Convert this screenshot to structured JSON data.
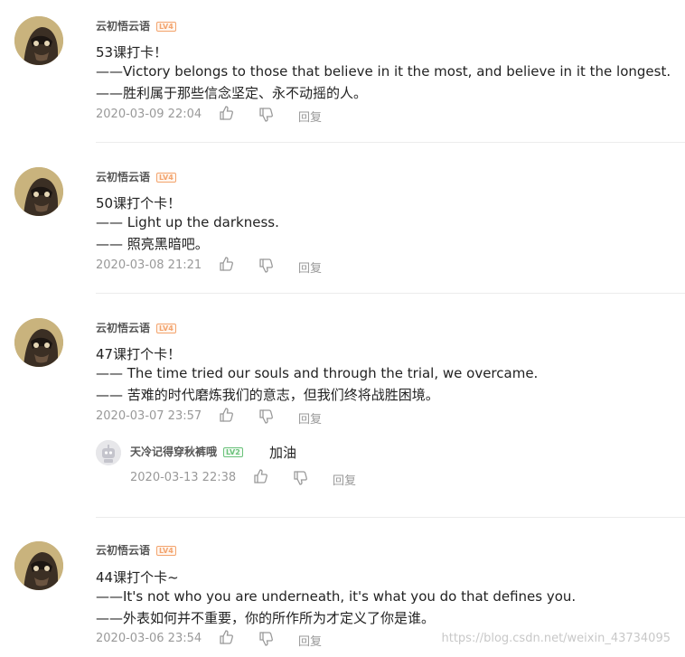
{
  "comments": [
    {
      "username": "云初悟云语",
      "level": "LV4",
      "lines": [
        "53课打卡！",
        "——Victory belongs to those that believe in it the most, and believe in it the longest.",
        "——胜利属于那些信念坚定、永不动摇的人。"
      ],
      "time": "2020-03-09 22:04",
      "reply_label": "回复"
    },
    {
      "username": "云初悟云语",
      "level": "LV4",
      "lines": [
        "50课打个卡！",
        "—— Light up the darkness.",
        "—— 照亮黑暗吧。"
      ],
      "time": "2020-03-08 21:21",
      "reply_label": "回复"
    },
    {
      "username": "云初悟云语",
      "level": "LV4",
      "lines": [
        "47课打个卡！",
        "—— The time tried our souls and through the trial, we overcame.",
        "—— 苦难的时代磨炼我们的意志，但我们终将战胜困境。"
      ],
      "time": "2020-03-07 23:57",
      "reply_label": "回复",
      "reply": {
        "username": "天冷记得穿秋裤哦",
        "level": "LV2",
        "text": "加油",
        "time": "2020-03-13 22:38",
        "reply_label": "回复"
      }
    },
    {
      "username": "云初悟云语",
      "level": "LV4",
      "lines": [
        "44课打个卡~",
        "——It's not who you are underneath, it's what you do that defines you.",
        "——外表如何并不重要，你的所作所为才定义了你是谁。"
      ],
      "time": "2020-03-06 23:54",
      "reply_label": "回复"
    }
  ],
  "watermark": "https://blog.csdn.net/weixin_43734095",
  "colors": {
    "level_orange": "#f3a46e",
    "level_green": "#6ac17a",
    "meta_gray": "#999999"
  },
  "icons": [
    "avatar-icon",
    "thumbs-up-icon",
    "thumbs-down-icon",
    "robot-avatar-icon"
  ]
}
